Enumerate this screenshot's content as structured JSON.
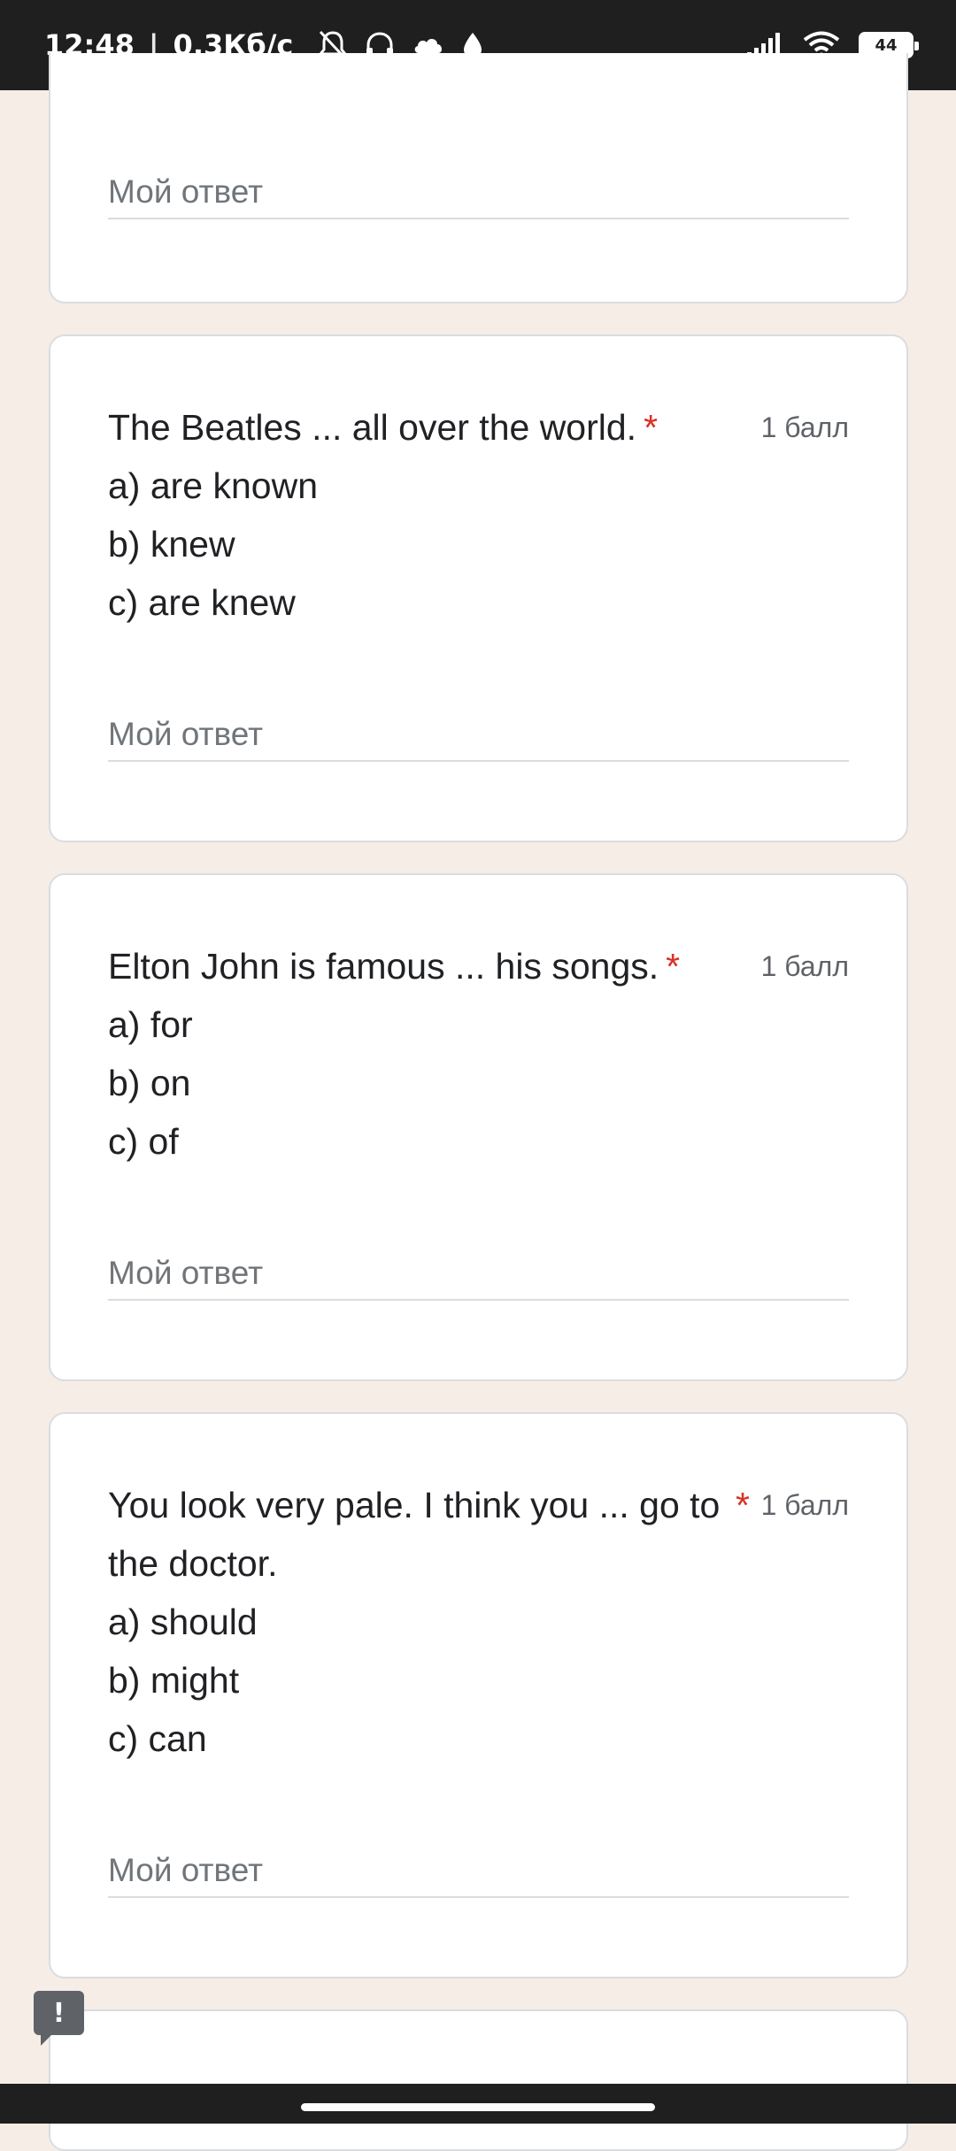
{
  "status_bar": {
    "time": "12:48",
    "separator": "|",
    "speed": "0,3Кб/с",
    "icons": [
      "bell-off-icon",
      "headphones-icon",
      "cloud-icon",
      "drop-icon"
    ],
    "right_icons": [
      "signal-icon",
      "wifi-icon",
      "battery-icon"
    ],
    "battery": "44"
  },
  "form": {
    "answer_placeholder": "Мой ответ",
    "required_mark": "*",
    "questions": [
      {
        "text": "The Beatles ... all over the world.",
        "points": "1 балл",
        "options": [
          "a) are known",
          "b) knew",
          "c) are knew"
        ]
      },
      {
        "text": "Elton John is famous ... his songs.",
        "points": "1 балл",
        "options": [
          "a) for",
          "b) on",
          "c) of"
        ]
      },
      {
        "text": "You look very pale. I think you ... go to the doctor.",
        "points": "1 балл",
        "options": [
          "a) should",
          "b) might",
          "c) can"
        ]
      }
    ]
  },
  "report_button": {
    "label": "!"
  }
}
